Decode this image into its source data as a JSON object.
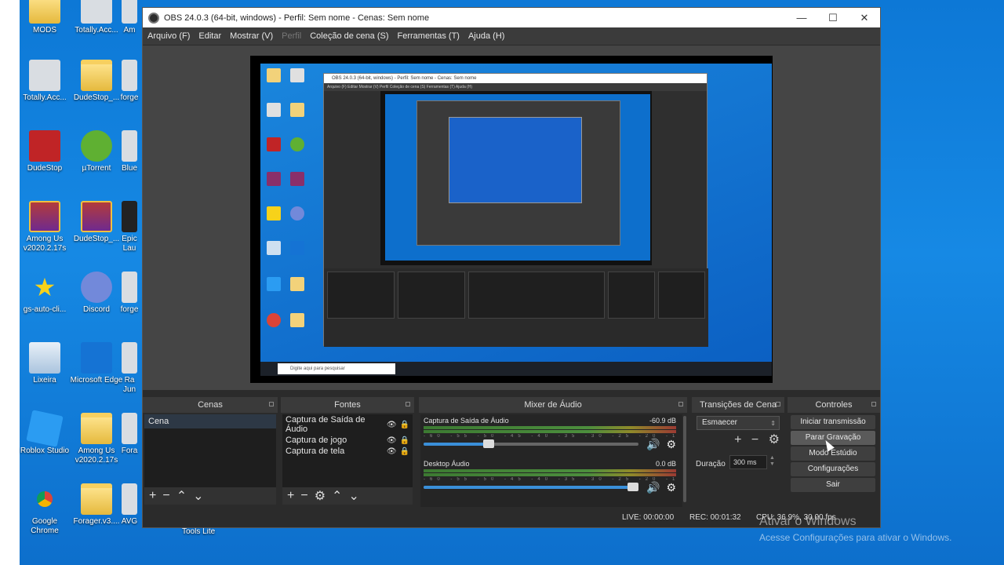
{
  "desktop": {
    "icons": [
      {
        "label": "MODS",
        "type": "folder"
      },
      {
        "label": "Totally.Acc...",
        "type": "app"
      },
      {
        "label": "Am",
        "type": "app"
      },
      {
        "label": "Totally.Acc...",
        "type": "app"
      },
      {
        "label": "DudeStop_...",
        "type": "folder"
      },
      {
        "label": "forge",
        "type": "app"
      },
      {
        "label": "DudeStop",
        "type": "dude"
      },
      {
        "label": "µTorrent",
        "type": "utor"
      },
      {
        "label": "Blue",
        "type": "app"
      },
      {
        "label": "Among Us v2020.2.17s",
        "type": "winrar"
      },
      {
        "label": "DudeStop_...",
        "type": "winrar"
      },
      {
        "label": "Epic Lau",
        "type": "app"
      },
      {
        "label": "gs-auto-cli...",
        "type": "star"
      },
      {
        "label": "Discord",
        "type": "discord"
      },
      {
        "label": "forge",
        "type": "app"
      },
      {
        "label": "Lixeira",
        "type": "recycle"
      },
      {
        "label": "Microsoft Edge",
        "type": "edge"
      },
      {
        "label": "Ra Jun",
        "type": "app"
      },
      {
        "label": "Roblox Studio",
        "type": "roblox"
      },
      {
        "label": "Among Us v2020.2.17s",
        "type": "folder"
      },
      {
        "label": "Fora",
        "type": "app"
      },
      {
        "label": "Google Chrome",
        "type": "chrome"
      },
      {
        "label": "Forager.v3....",
        "type": "folder"
      },
      {
        "label": "AVG",
        "type": "app"
      }
    ],
    "extra_label": "Tools Lite",
    "watermark_title": "Ativar o Windows",
    "watermark_sub": "Acesse Configurações para ativar o Windows."
  },
  "window": {
    "title": "OBS 24.0.3 (64-bit, windows) - Perfil: Sem nome - Cenas: Sem nome",
    "minimize": "—",
    "maximize": "☐",
    "close": "✕"
  },
  "menu": [
    "Arquivo (F)",
    "Editar",
    "Mostrar (V)",
    "Perfil",
    "Coleção de cena (S)",
    "Ferramentas (T)",
    "Ajuda (H)"
  ],
  "preview": {
    "nested_title": "OBS 24.0.3 (64-bit, windows) - Perfil: Sem nome - Cenas: Sem nome",
    "nested_menu": "Arquivo (F)   Editar   Mostrar (V)   Perfil   Coleção de cena (S)   Ferramentas (T)   Ajuda (H)",
    "taskbar_search": "Digite aqui para pesquisar"
  },
  "scenes": {
    "title": "Cenas",
    "items": [
      "Cena"
    ]
  },
  "sources": {
    "title": "Fontes",
    "items": [
      "Captura de Saída de Áudio",
      "Captura de jogo",
      "Captura de tela"
    ]
  },
  "mixer": {
    "title": "Mixer de Áudio",
    "tracks": [
      {
        "name": "Captura de Saída de Áudio",
        "db": "-60.9 dB",
        "volume": 0.33
      },
      {
        "name": "Desktop Áudio",
        "db": "0.0 dB",
        "volume": 1.0
      }
    ],
    "ticks": "-60 -55 -50 -45 -40 -35 -30 -25 -20 -15 -10 -5 0"
  },
  "transitions": {
    "title": "Transições de Cena",
    "selected": "Esmaecer",
    "duration_label": "Duração",
    "duration_value": "300 ms"
  },
  "controls": {
    "title": "Controles",
    "buttons": [
      "Iniciar transmissão",
      "Parar Gravação",
      "Modo Estúdio",
      "Configurações",
      "Sair"
    ]
  },
  "status": {
    "live": "LIVE: 00:00:00",
    "rec": "REC: 00:01:32",
    "cpu": "CPU: 36.9%, 30.00 fps"
  }
}
